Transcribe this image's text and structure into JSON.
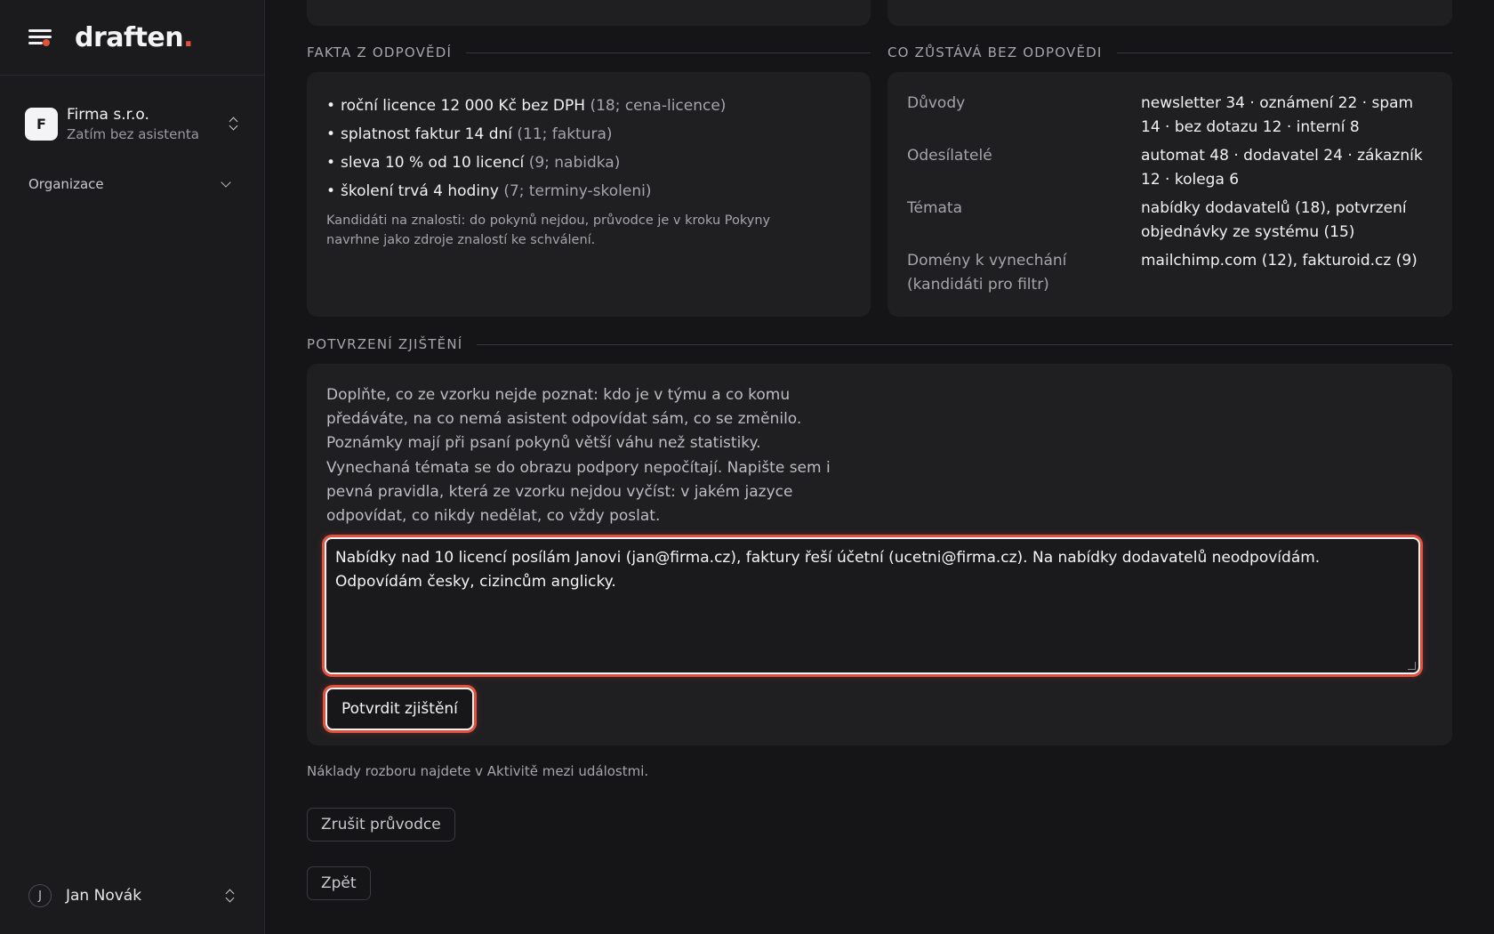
{
  "brand": {
    "logo_text": "draften",
    "logo_dot": ".",
    "accent_color": "#e2513c"
  },
  "sidebar": {
    "org": {
      "avatar_letter": "F",
      "name": "Firma s.r.o.",
      "subtitle": "Zatím bez asistenta"
    },
    "section_label": "Organizace",
    "user": {
      "avatar_letter": "J",
      "name": "Jan Novák"
    }
  },
  "facts": {
    "heading": "FAKTA Z ODPOVĚDÍ",
    "items": [
      {
        "text": "roční licence 12 000 Kč bez DPH",
        "meta": "(18; cena-licence)"
      },
      {
        "text": "splatnost faktur 14 dní",
        "meta": "(11; faktura)"
      },
      {
        "text": "sleva 10 % od 10 licencí",
        "meta": "(9; nabidka)"
      },
      {
        "text": "školení trvá 4 hodiny",
        "meta": "(7; terminy-skoleni)"
      }
    ],
    "note": "Kandidáti na znalosti: do pokynů nejdou, průvodce je v kroku Pokyny navrhne jako zdroje znalostí ke schválení."
  },
  "unanswered": {
    "heading": "CO ZŮSTÁVÁ BEZ ODPOVĚDI",
    "rows": [
      {
        "label": "Důvody",
        "value": "newsletter 34 · oznámení 22 · spam 14 · bez dotazu 12 · interní 8"
      },
      {
        "label": "Odesílatelé",
        "value": "automat 48 · dodavatel 24 · zákazník 12 · kolega 6"
      },
      {
        "label": "Témata",
        "value": "nabídky dodavatelů (18), potvrzení objednávky ze systému (15)"
      },
      {
        "label": "Domény k vynechání (kandidáti pro filtr)",
        "value": "mailchimp.com (12), fakturoid.cz (9)"
      }
    ]
  },
  "confirmation": {
    "heading": "POTVRZENÍ ZJIŠTĚNÍ",
    "intro": "Doplňte, co ze vzorku nejde poznat: kdo je v týmu a co komu předáváte, na co nemá asistent odpovídat sám, co se změnilo. Poznámky mají při psaní pokynů větší váhu než statistiky. Vynechaná témata se do obrazu podpory nepočítají. Napište sem i pevná pravidla, která ze vzorku nejdou vyčíst: v jakém jazyce odpovídat, co nikdy nedělat, co vždy poslat.",
    "textarea_value": "Nabídky nad 10 licencí posílám Janovi (jan@firma.cz), faktury řeší účetní (ucetni@firma.cz). Na nabídky dodavatelů neodpovídám. Odpovídám česky, cizincům anglicky.",
    "submit_label": "Potvrdit zjištění"
  },
  "footer": {
    "cost_note": "Náklady rozboru najdete v Aktivitě mezi událostmi.",
    "cancel_label": "Zrušit průvodce",
    "back_label": "Zpět"
  },
  "icons": {
    "menu": "menu-icon",
    "org_switch": "chevron-up-down-icon",
    "section": "chevron-down-icon",
    "user_switch": "chevron-up-down-icon"
  }
}
